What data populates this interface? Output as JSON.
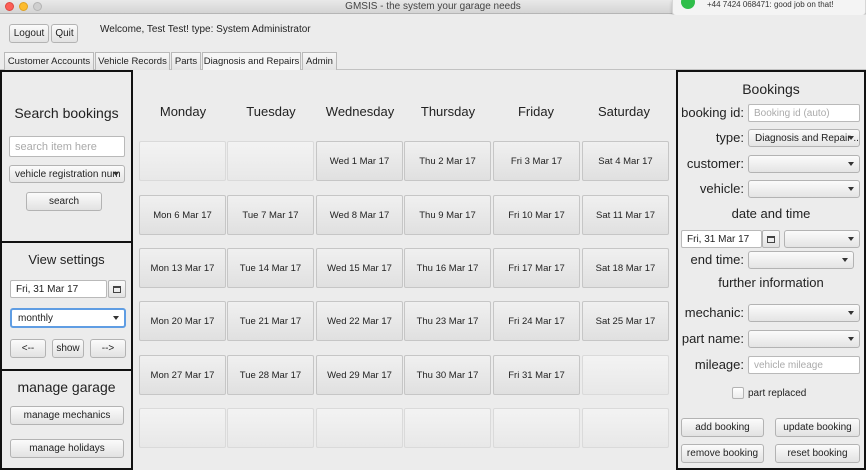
{
  "window": {
    "title": "GMSIS - the system your garage needs"
  },
  "notification": {
    "message": "+44 7424 068471: good job on that!"
  },
  "topbar": {
    "logout_label": "Logout",
    "quit_label": "Quit",
    "welcome_text": "Welcome, Test Test! type: System Administrator"
  },
  "tabs": [
    {
      "label": "Customer Accounts"
    },
    {
      "label": "Vehicle Records"
    },
    {
      "label": "Parts"
    },
    {
      "label": "Diagnosis and Repairs",
      "active": true
    },
    {
      "label": "Admin"
    }
  ],
  "left": {
    "search_title": "Search bookings",
    "search_placeholder": "search item here",
    "search_by": "vehicle registration num",
    "search_button": "search",
    "view_title": "View settings",
    "view_date": "Fri, 31 Mar 17",
    "view_mode": "monthly",
    "prev_label": "<--",
    "show_label": "show",
    "next_label": "-->",
    "manage_title": "manage garage",
    "manage_mechanics": "manage mechanics",
    "manage_holidays": "manage holidays"
  },
  "calendar": {
    "days": [
      "Monday",
      "Tuesday",
      "Wednesday",
      "Thursday",
      "Friday",
      "Saturday"
    ],
    "weeks": [
      [
        "",
        "",
        "Wed 1 Mar 17",
        "Thu 2 Mar 17",
        "Fri 3 Mar 17",
        "Sat 4 Mar 17"
      ],
      [
        "Mon 6 Mar 17",
        "Tue 7 Mar 17",
        "Wed 8 Mar 17",
        "Thu 9 Mar 17",
        "Fri 10 Mar 17",
        "Sat 11 Mar 17"
      ],
      [
        "Mon 13 Mar 17",
        "Tue 14 Mar 17",
        "Wed 15 Mar 17",
        "Thu 16 Mar 17",
        "Fri 17 Mar 17",
        "Sat 18 Mar 17"
      ],
      [
        "Mon 20 Mar 17",
        "Tue 21 Mar 17",
        "Wed 22 Mar 17",
        "Thu 23 Mar 17",
        "Fri 24 Mar 17",
        "Sat 25 Mar 17"
      ],
      [
        "Mon 27 Mar 17",
        "Tue 28 Mar 17",
        "Wed 29 Mar 17",
        "Thu 30 Mar 17",
        "Fri 31 Mar 17",
        ""
      ],
      [
        "",
        "",
        "",
        "",
        "",
        ""
      ]
    ]
  },
  "bookings": {
    "title": "Bookings",
    "booking_id_label": "booking id:",
    "booking_id_placeholder": "Booking id (auto)",
    "type_label": "type:",
    "type_value": "Diagnosis and Repair ...",
    "customer_label": "customer:",
    "vehicle_label": "vehicle:",
    "datetime_title": "date and time",
    "date_value": "Fri, 31 Mar 17",
    "end_time_label": "end time:",
    "further_title": "further information",
    "mechanic_label": "mechanic:",
    "part_name_label": "part name:",
    "mileage_label": "mileage:",
    "mileage_placeholder": "vehicle mileage",
    "part_replaced_label": "part replaced",
    "add_booking": "add booking",
    "update_booking": "update booking",
    "remove_booking": "remove booking",
    "reset_booking": "reset booking"
  }
}
